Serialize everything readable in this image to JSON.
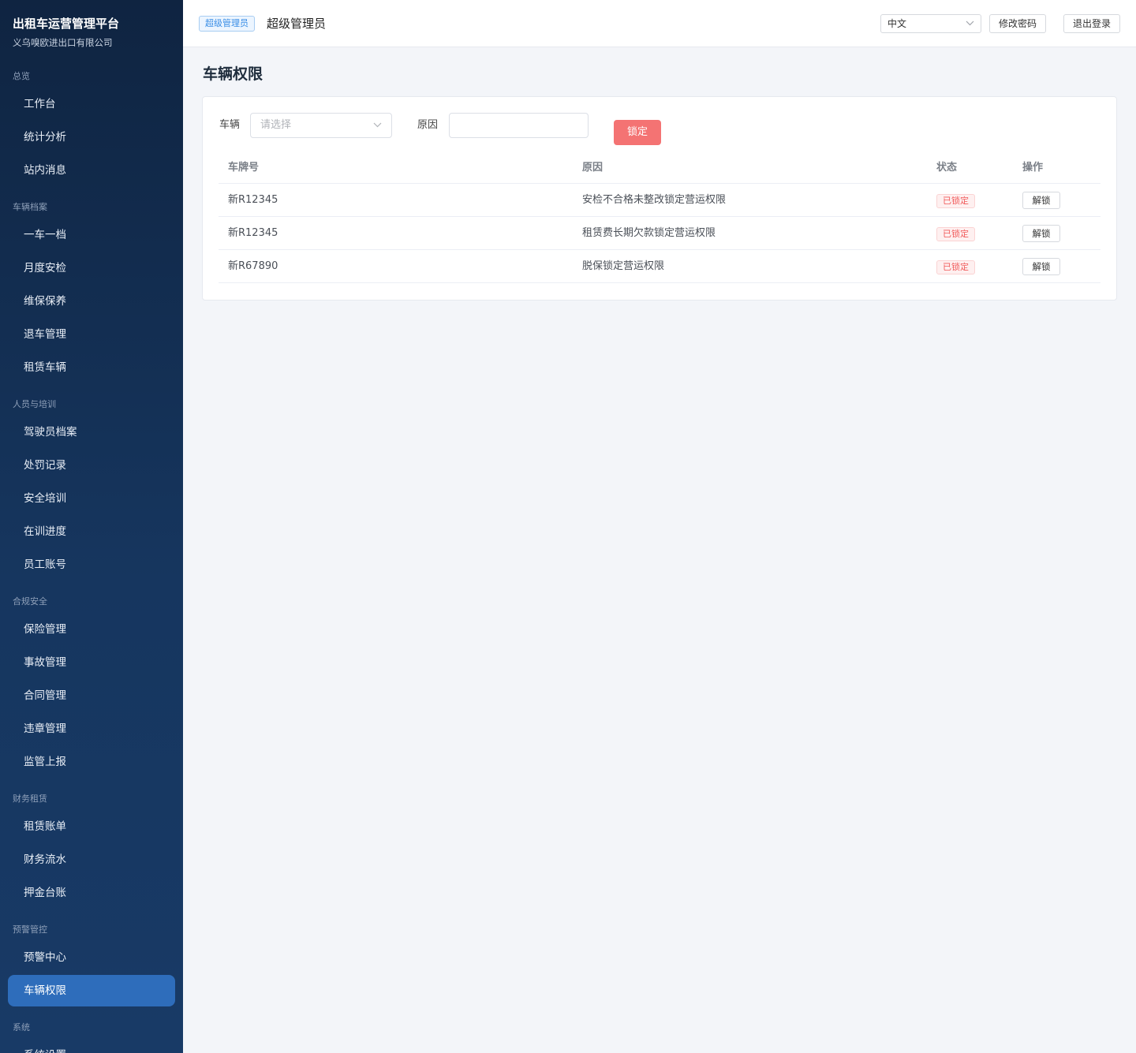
{
  "sidebar": {
    "brand_title": "出租车运营管理平台",
    "brand_subtitle": "义乌嗅欧进出口有限公司",
    "groups": [
      {
        "label": "总览",
        "items": [
          "工作台",
          "统计分析",
          "站内消息"
        ]
      },
      {
        "label": "车辆档案",
        "items": [
          "一车一档",
          "月度安检",
          "维保保养",
          "退车管理",
          "租赁车辆"
        ]
      },
      {
        "label": "人员与培训",
        "items": [
          "驾驶员档案",
          "处罚记录",
          "安全培训",
          "在训进度",
          "员工账号"
        ]
      },
      {
        "label": "合规安全",
        "items": [
          "保险管理",
          "事故管理",
          "合同管理",
          "违章管理",
          "监管上报"
        ]
      },
      {
        "label": "财务租赁",
        "items": [
          "租赁账单",
          "财务流水",
          "押金台账"
        ]
      },
      {
        "label": "预警管控",
        "items": [
          "预警中心",
          "车辆权限"
        ]
      },
      {
        "label": "系统",
        "items": [
          "系统设置"
        ]
      }
    ],
    "active_item": "车辆权限"
  },
  "header": {
    "role_badge": "超级管理员",
    "role_name": "超级管理员",
    "language": "中文",
    "change_password": "修改密码",
    "logout": "退出登录"
  },
  "page": {
    "title": "车辆权限",
    "form": {
      "vehicle_label": "车辆",
      "vehicle_placeholder": "请选择",
      "reason_label": "原因",
      "reason_value": "",
      "lock_button": "锁定"
    },
    "table": {
      "columns": [
        "车牌号",
        "原因",
        "状态",
        "操作"
      ],
      "rows": [
        {
          "plate": "新R12345",
          "reason": "安检不合格未整改锁定营运权限",
          "status": "已锁定",
          "action": "解锁"
        },
        {
          "plate": "新R12345",
          "reason": "租赁费长期欠款锁定营运权限",
          "status": "已锁定",
          "action": "解锁"
        },
        {
          "plate": "新R67890",
          "reason": "脱保锁定营运权限",
          "status": "已锁定",
          "action": "解锁"
        }
      ]
    }
  },
  "colors": {
    "sidebar_bg": "#13304f",
    "sidebar_active": "#2e6dbb",
    "lock_button": "#f47373",
    "locked_tag": "#f15a5a",
    "role_badge": "#3a8ee6"
  }
}
